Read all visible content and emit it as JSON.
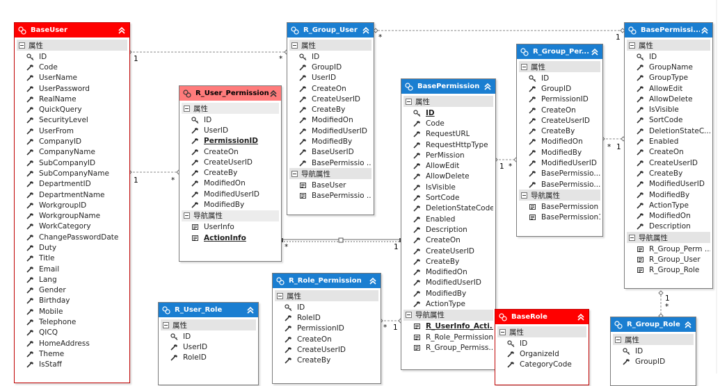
{
  "entities": [
    {
      "id": "baseuser",
      "title": "BaseUser",
      "color": "red",
      "sections": [
        {
          "title": "属性",
          "items": [
            {
              "name": "ID",
              "icon": "key"
            },
            {
              "name": "Code"
            },
            {
              "name": "UserName"
            },
            {
              "name": "UserPassword"
            },
            {
              "name": "RealName"
            },
            {
              "name": "QuickQuery"
            },
            {
              "name": "SecurityLevel"
            },
            {
              "name": "UserFrom"
            },
            {
              "name": "CompanyID"
            },
            {
              "name": "CompanyName"
            },
            {
              "name": "SubCompanyID"
            },
            {
              "name": "SubCompanyName"
            },
            {
              "name": "DepartmentID"
            },
            {
              "name": "DepartmentName"
            },
            {
              "name": "WorkgroupID"
            },
            {
              "name": "WorkgroupName"
            },
            {
              "name": "WorkCategory"
            },
            {
              "name": "ChangePasswordDate"
            },
            {
              "name": "Duty"
            },
            {
              "name": "Title"
            },
            {
              "name": "Email"
            },
            {
              "name": "Lang"
            },
            {
              "name": "Gender"
            },
            {
              "name": "Birthday"
            },
            {
              "name": "Mobile"
            },
            {
              "name": "Telephone"
            },
            {
              "name": "QICQ"
            },
            {
              "name": "HomeAddress"
            },
            {
              "name": "Theme"
            },
            {
              "name": "IsStaff"
            }
          ]
        }
      ]
    },
    {
      "id": "r_user_permission",
      "title": "R_User_Permission",
      "color": "pink",
      "sections": [
        {
          "title": "属性",
          "items": [
            {
              "name": "ID",
              "icon": "key"
            },
            {
              "name": "UserID"
            },
            {
              "name": "PermissionID",
              "bold": true
            },
            {
              "name": "CreateOn"
            },
            {
              "name": "CreateUserID"
            },
            {
              "name": "CreateBy"
            },
            {
              "name": "ModifiedOn"
            },
            {
              "name": "ModifiedUserID"
            },
            {
              "name": "ModifiedBy"
            }
          ]
        },
        {
          "title": "导航属性",
          "items": [
            {
              "name": "UserInfo",
              "icon": "nav"
            },
            {
              "name": "ActionInfo",
              "icon": "nav",
              "bold": true
            }
          ]
        }
      ]
    },
    {
      "id": "r_group_user",
      "title": "R_Group_User",
      "color": "blue",
      "sections": [
        {
          "title": "属性",
          "items": [
            {
              "name": "ID",
              "icon": "key"
            },
            {
              "name": "GroupID"
            },
            {
              "name": "UserID"
            },
            {
              "name": "CreateOn"
            },
            {
              "name": "CreateUserID"
            },
            {
              "name": "CreateBy"
            },
            {
              "name": "ModifiedOn"
            },
            {
              "name": "ModifiedUserID"
            },
            {
              "name": "ModifiedBy"
            },
            {
              "name": "BaseUserID"
            },
            {
              "name": "BasePermissio ..."
            }
          ]
        },
        {
          "title": "导航属性",
          "items": [
            {
              "name": "BaseUser",
              "icon": "nav"
            },
            {
              "name": "BasePermissio ...",
              "icon": "nav"
            }
          ]
        }
      ]
    },
    {
      "id": "basepermission",
      "title": "BasePermission",
      "color": "blue",
      "sections": [
        {
          "title": "属性",
          "items": [
            {
              "name": "ID",
              "icon": "key",
              "bold": true
            },
            {
              "name": "Code"
            },
            {
              "name": "RequestURL"
            },
            {
              "name": "RequestHttpType"
            },
            {
              "name": "PerMission"
            },
            {
              "name": "AllowEdit"
            },
            {
              "name": "AllowDelete"
            },
            {
              "name": "IsVisible"
            },
            {
              "name": "SortCode"
            },
            {
              "name": "DeletionStateCode"
            },
            {
              "name": "Enabled"
            },
            {
              "name": "Description"
            },
            {
              "name": "CreateOn"
            },
            {
              "name": "CreateUserID"
            },
            {
              "name": "CreateBy"
            },
            {
              "name": "ModifiedOn"
            },
            {
              "name": "ModifiedUserID"
            },
            {
              "name": "ModifiedBy"
            },
            {
              "name": "ActionType"
            }
          ]
        },
        {
          "title": "导航属性",
          "items": [
            {
              "name": "R_UserInfo_Acti...",
              "icon": "nav",
              "bold": true
            },
            {
              "name": "R_Role_Permission",
              "icon": "nav"
            },
            {
              "name": "R_Group_Permiss...",
              "icon": "nav"
            }
          ]
        }
      ]
    },
    {
      "id": "r_group_per",
      "title": "R_Group_Per...",
      "color": "blue",
      "sections": [
        {
          "title": "属性",
          "items": [
            {
              "name": "ID",
              "icon": "key"
            },
            {
              "name": "GroupID"
            },
            {
              "name": "PermissionID"
            },
            {
              "name": "CreateOn"
            },
            {
              "name": "CreateUserID"
            },
            {
              "name": "CreateBy"
            },
            {
              "name": "ModifiedOn"
            },
            {
              "name": "ModifiedBy"
            },
            {
              "name": "ModifiedUserID"
            },
            {
              "name": "BasePermissio..."
            },
            {
              "name": "BasePermissio..."
            }
          ]
        },
        {
          "title": "导航属性",
          "items": [
            {
              "name": "BasePermission",
              "icon": "nav"
            },
            {
              "name": "BasePermission1",
              "icon": "nav"
            }
          ]
        }
      ]
    },
    {
      "id": "basepermissi",
      "title": "BasePermissi...",
      "color": "blue",
      "sections": [
        {
          "title": "属性",
          "items": [
            {
              "name": "ID",
              "icon": "key"
            },
            {
              "name": "GroupName"
            },
            {
              "name": "GroupType"
            },
            {
              "name": "AllowEdit"
            },
            {
              "name": "AllowDelete"
            },
            {
              "name": "IsVisible"
            },
            {
              "name": "SortCode"
            },
            {
              "name": "DeletionStateC..."
            },
            {
              "name": "Enabled"
            },
            {
              "name": "CreateOn"
            },
            {
              "name": "CreateUserID"
            },
            {
              "name": "CreateBy"
            },
            {
              "name": "ModifiedUserID"
            },
            {
              "name": "ModifiedBy"
            },
            {
              "name": "ActionType"
            },
            {
              "name": "ModifiedOn"
            },
            {
              "name": "Description"
            }
          ]
        },
        {
          "title": "导航属性",
          "items": [
            {
              "name": "R_Group_Perm ...",
              "icon": "nav"
            },
            {
              "name": "R_Group_User",
              "icon": "nav"
            },
            {
              "name": "R_Group_Role",
              "icon": "nav"
            }
          ]
        }
      ]
    },
    {
      "id": "r_role_permission",
      "title": "R_Role_Permission",
      "color": "blue",
      "sections": [
        {
          "title": "属性",
          "items": [
            {
              "name": "ID",
              "icon": "key"
            },
            {
              "name": "RoleID"
            },
            {
              "name": "PermissionID"
            },
            {
              "name": "CreateOn"
            },
            {
              "name": "CreateUserID"
            },
            {
              "name": "CreateBy"
            }
          ]
        }
      ]
    },
    {
      "id": "r_user_role",
      "title": "R_User_Role",
      "color": "blue",
      "sections": [
        {
          "title": "属性",
          "items": [
            {
              "name": "ID",
              "icon": "key"
            },
            {
              "name": "UserID"
            },
            {
              "name": "RoleID"
            }
          ]
        }
      ]
    },
    {
      "id": "baserole",
      "title": "BaseRole",
      "color": "red",
      "sections": [
        {
          "title": "属性",
          "items": [
            {
              "name": "ID",
              "icon": "key"
            },
            {
              "name": "OrganizeId"
            },
            {
              "name": "CategoryCode"
            }
          ]
        }
      ]
    },
    {
      "id": "r_group_role",
      "title": "R_Group_Role",
      "color": "blue",
      "sections": [
        {
          "title": "属性",
          "items": [
            {
              "name": "ID",
              "icon": "key"
            },
            {
              "name": "GroupID"
            }
          ]
        }
      ]
    }
  ],
  "cardinalities": [
    {
      "id": "c1",
      "text": "1"
    },
    {
      "id": "c2",
      "text": "*"
    },
    {
      "id": "c3",
      "text": "*"
    },
    {
      "id": "c4",
      "text": "1"
    },
    {
      "id": "c5",
      "text": "1"
    },
    {
      "id": "c6",
      "text": "*"
    },
    {
      "id": "c7",
      "text": "*"
    },
    {
      "id": "c8",
      "text": "1"
    },
    {
      "id": "c9",
      "text": "1"
    },
    {
      "id": "c10",
      "text": "*"
    },
    {
      "id": "c11",
      "text": "*"
    },
    {
      "id": "c12",
      "text": "1"
    },
    {
      "id": "c13",
      "text": "*"
    },
    {
      "id": "c14",
      "text": "1"
    },
    {
      "id": "c15",
      "text": "1"
    },
    {
      "id": "c16",
      "text": "*"
    }
  ]
}
